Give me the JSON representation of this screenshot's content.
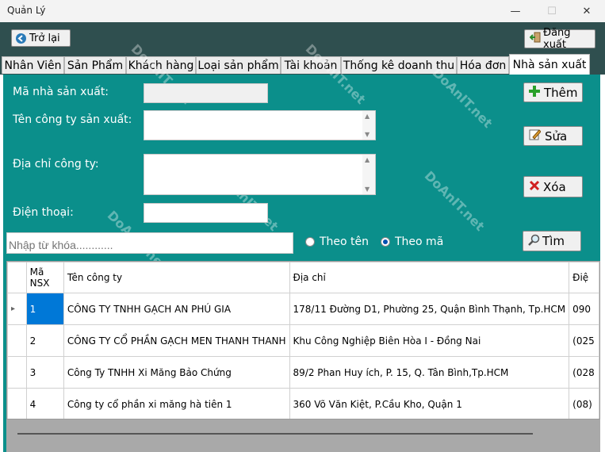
{
  "window": {
    "title": "Quản Lý",
    "minimize_glyph": "—",
    "maximize_glyph": "☐",
    "close_glyph": "✕"
  },
  "toolbar": {
    "back_label": "Trở lại",
    "logout_label": "Đăng xuất"
  },
  "tabs": [
    {
      "label": "Nhân Viên"
    },
    {
      "label": "Sản Phẩm"
    },
    {
      "label": "Khách hàng"
    },
    {
      "label": "Loại sản phẩm"
    },
    {
      "label": "Tài khoản"
    },
    {
      "label": "Thống kê doanh thu"
    },
    {
      "label": "Hóa đơn"
    },
    {
      "label": "Nhà sản xuất",
      "active": true
    }
  ],
  "form": {
    "id_label": "Mã nhà sản xuất:",
    "company_label": "Tên công ty sản xuất:",
    "address_label": "Địa chỉ công ty:",
    "phone_label": "Điện thoại:",
    "id_value": "",
    "company_value": "",
    "address_value": "",
    "phone_value": ""
  },
  "actions": {
    "add_label": "Thêm",
    "edit_label": "Sửa",
    "delete_label": "Xóa",
    "search_label": "Tìm"
  },
  "search": {
    "placeholder": "Nhập từ khóa............",
    "by_name_label": "Theo tên",
    "by_id_label": "Theo mã",
    "selected": "by_id"
  },
  "grid": {
    "columns": [
      "Mã NSX",
      "Tên công ty",
      "Địa chỉ",
      "Điệ"
    ],
    "rows": [
      {
        "id": "1",
        "name": "CÔNG TY TNHH GẠCH AN PHÚ GIA",
        "address": "178/11 Đường D1, Phường 25, Quận Bình Thạnh, Tp.HCM",
        "phone": "090",
        "selected": true
      },
      {
        "id": "2",
        "name": "CÔNG TY CỔ PHẦN GẠCH MEN THANH THANH",
        "address": "Khu Công Nghiệp Biên Hòa I - Đồng Nai",
        "phone": "(025"
      },
      {
        "id": "3",
        "name": "Công Ty TNHH Xi Măng Bảo Chứng",
        "address": "89/2 Phan Huy ích, P. 15, Q. Tân Bình,Tp.HCM",
        "phone": "(028"
      },
      {
        "id": "4",
        "name": "Công ty cổ phần xi măng hà tiên 1",
        "address": "360 Võ Văn Kiệt, P.Cầu Kho, Quận 1",
        "phone": "(08)"
      }
    ],
    "row_marker": "▸"
  },
  "watermark": "DoAnIT.net",
  "colors": {
    "panel": "#0b8f8b",
    "topbar": "#2f4f4f",
    "selection": "#0078d7"
  }
}
